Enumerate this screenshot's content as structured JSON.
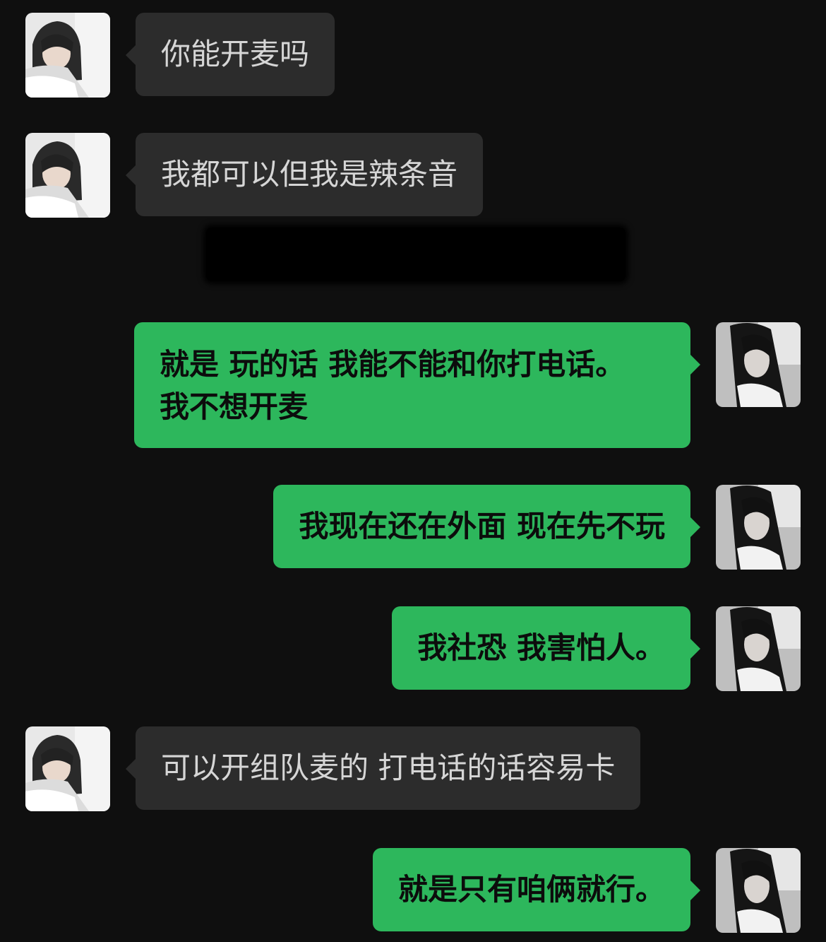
{
  "chat": {
    "messages": [
      {
        "side": "in",
        "text": "你能开麦吗"
      },
      {
        "side": "in",
        "text": "我都可以但我是辣条音"
      },
      {
        "side": "out",
        "lines": [
          "就是 玩的话 我能不能和你打电话。",
          "我不想开麦"
        ]
      },
      {
        "side": "out",
        "text": "我现在还在外面 现在先不玩"
      },
      {
        "side": "out",
        "text": "我社恐 我害怕人。"
      },
      {
        "side": "in",
        "text": "可以开组队麦的 打电话的话容易卡"
      },
      {
        "side": "out",
        "text": "就是只有咱俩就行。"
      }
    ]
  },
  "colors": {
    "background": "#0f0f0f",
    "incoming_bubble": "#2c2c2c",
    "outgoing_bubble": "#2db75c",
    "incoming_text": "#d6d6d6",
    "outgoing_text": "#0c0c0c"
  }
}
